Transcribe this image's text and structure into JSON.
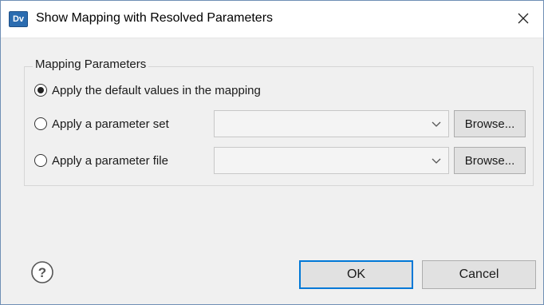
{
  "window": {
    "title": "Show Mapping with Resolved Parameters",
    "app_icon_text": "Dv"
  },
  "group": {
    "label": "Mapping Parameters"
  },
  "options": [
    {
      "label": "Apply the default values in the mapping",
      "selected": true
    },
    {
      "label": "Apply a parameter set",
      "selected": false,
      "combo_value": "",
      "browse_label": "Browse..."
    },
    {
      "label": "Apply a parameter file",
      "selected": false,
      "combo_value": "",
      "browse_label": "Browse..."
    }
  ],
  "buttons": {
    "ok": "OK",
    "cancel": "Cancel"
  },
  "icons": {
    "close": "close-icon",
    "help": "help-icon",
    "chevron": "chevron-down-icon"
  },
  "colors": {
    "accent": "#0078d7",
    "dialog_bg": "#f0f0f0",
    "app_icon": "#2b6cb0"
  }
}
